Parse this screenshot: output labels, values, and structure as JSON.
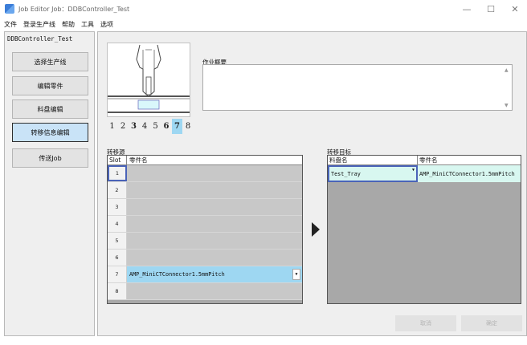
{
  "window": {
    "title": "Job Editor Job：DDBController_Test",
    "controls": [
      "—",
      "☐",
      "✕"
    ]
  },
  "menu": [
    "文件",
    "登录生产线",
    "帮助",
    "工具",
    "选项"
  ],
  "sidebar": {
    "title": "DDBController_Test",
    "buttons": [
      {
        "label": "选择生产线",
        "active": false
      },
      {
        "label": "编辑零件",
        "active": false
      },
      {
        "label": "料盘编辑",
        "active": false
      },
      {
        "label": "转移信息编辑",
        "active": true
      },
      {
        "label": "传送Job",
        "active": false
      }
    ]
  },
  "slot_strip": [
    {
      "label": "1",
      "state": "normal"
    },
    {
      "label": "2",
      "state": "normal"
    },
    {
      "label": "3",
      "state": "bold"
    },
    {
      "label": "4",
      "state": "normal"
    },
    {
      "label": "5",
      "state": "normal"
    },
    {
      "label": "6",
      "state": "bold"
    },
    {
      "label": "7",
      "state": "selected"
    },
    {
      "label": "8",
      "state": "normal"
    }
  ],
  "summary": {
    "label": "作业概要",
    "value": ""
  },
  "source": {
    "label": "转移源",
    "headers": {
      "slot": "Slot",
      "part": "零件名"
    },
    "rows": [
      {
        "slot": "1",
        "part": ""
      },
      {
        "slot": "2",
        "part": ""
      },
      {
        "slot": "3",
        "part": ""
      },
      {
        "slot": "4",
        "part": ""
      },
      {
        "slot": "5",
        "part": ""
      },
      {
        "slot": "6",
        "part": ""
      },
      {
        "slot": "7",
        "part": "AMP_MiniCTConnector1.5mmPitch"
      },
      {
        "slot": "8",
        "part": ""
      }
    ]
  },
  "target": {
    "label": "转移目标",
    "headers": {
      "tray": "料盘名",
      "part": "零件名"
    },
    "rows": [
      {
        "tray": "Test_Tray",
        "part": "AMP_MiniCTConnector1.5mmPitch"
      }
    ]
  },
  "actions": {
    "cancel": "取消",
    "confirm": "确定"
  },
  "colors": {
    "selected_row": "#9ed7f2",
    "active_sidebar": "#c9e3f7",
    "target_row": "#d8f7f0",
    "focus_border": "#4a63b8"
  }
}
